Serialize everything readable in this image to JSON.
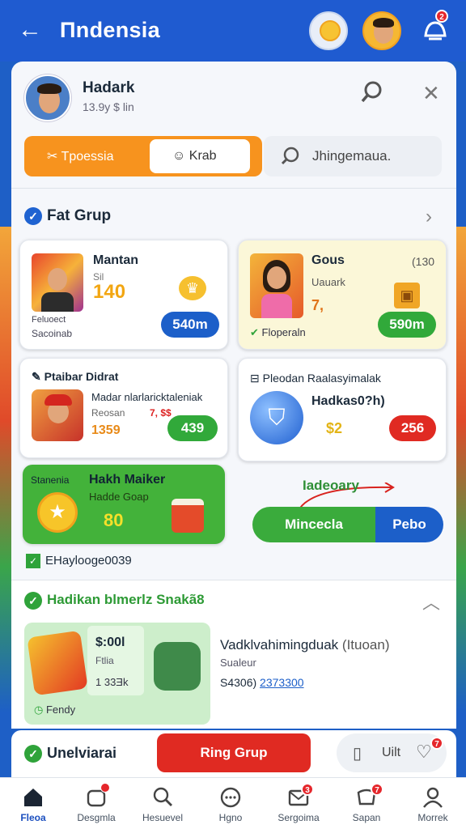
{
  "header": {
    "back": "←",
    "title": "Πndensia"
  },
  "notifications": {
    "badge": "2"
  },
  "profile": {
    "name": "Hadark",
    "meta": "13.9y $ lin"
  },
  "tabs": [
    {
      "label": "Tpoessia"
    },
    {
      "label": "Krab"
    }
  ],
  "search": {
    "placeholder": "Jhingemaua."
  },
  "section1": {
    "title": "Fat Grup"
  },
  "cards": {
    "c1": {
      "title": "Mantan",
      "sub": "Sil",
      "price": "140",
      "foot1": "Feluoect",
      "foot2": "Sacoinab",
      "btn": "540m"
    },
    "c2": {
      "title": "Gous",
      "tag": "(130",
      "sub": "Uauark",
      "price": "7,",
      "foot": "Floperaln",
      "btn": "590m"
    },
    "c3": {
      "head": "Ptaibar Didrat",
      "title": "Madar nlarlaricktaleniak",
      "sub": "Reosan",
      "sub2": "7, $$",
      "price": "1359",
      "btn": "439"
    },
    "c4": {
      "head": "Pleodan Raalasyimalak",
      "title": "Hadkas0?h)",
      "price": "$2",
      "btn": "256"
    },
    "c5": {
      "small": "Stanenia",
      "title": "Hakh Maiker",
      "sub": "Hadde Goap",
      "value": "80"
    },
    "c6": {
      "label": "Iadeoary",
      "btnA": "Mincecla",
      "btnB": "Pebo"
    }
  },
  "footnote": "EHaylooge0039",
  "section2": {
    "title": "Hadikan blmerlz Snakã8"
  },
  "promo": {
    "price": "$:00l",
    "sub": "Ftlia",
    "num": "1 33Ǝk",
    "foot": "Fendy",
    "title": "Vadklvahimingduak",
    "title2": "(Ituoan)",
    "sub2": "Sualeur",
    "line": "S4306)",
    "link": "2373300"
  },
  "section3": {
    "title": "Unelviarai",
    "cta": "Ring Grup",
    "util": "Uilt",
    "util_badge": "7"
  },
  "bottomnav": [
    {
      "label": "Fleoa"
    },
    {
      "label": "Desgmla",
      "badge": ""
    },
    {
      "label": "Hesuevel"
    },
    {
      "label": "Hgno"
    },
    {
      "label": "Sergoima",
      "badge": "3"
    },
    {
      "label": "Sapan",
      "badge": "7"
    },
    {
      "label": "Morrek"
    }
  ]
}
